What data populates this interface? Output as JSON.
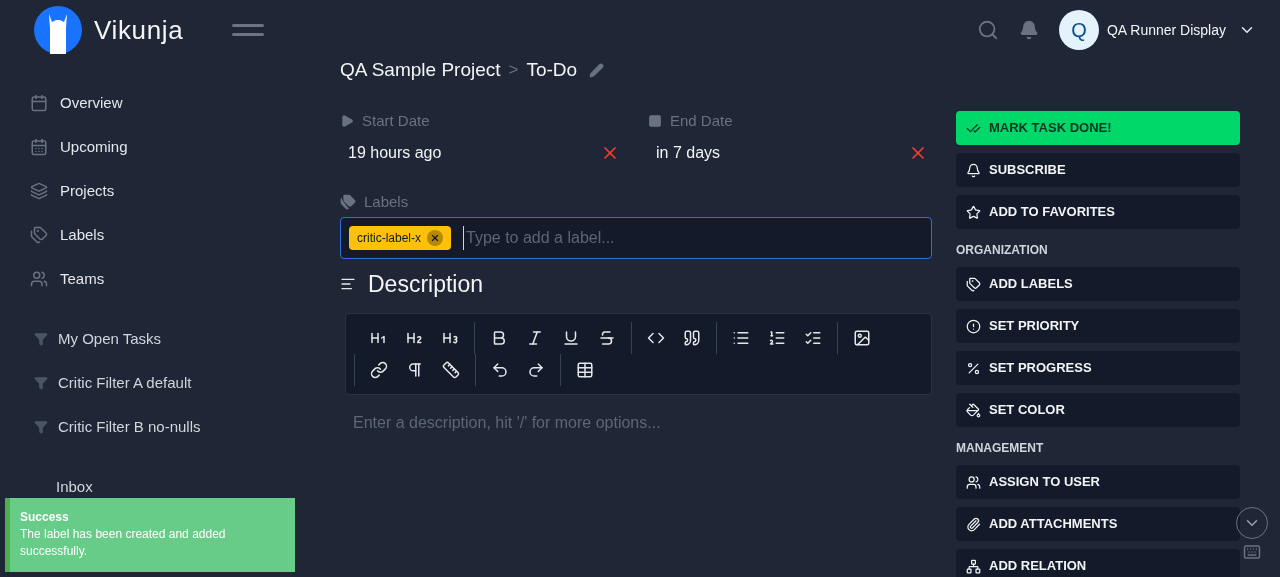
{
  "header": {
    "brand": "Vikunja",
    "user": {
      "initial": "Q",
      "name": "QA Runner Display"
    }
  },
  "sidebar": {
    "nav": [
      {
        "kind": "overview",
        "label": "Overview"
      },
      {
        "kind": "upcoming",
        "label": "Upcoming"
      },
      {
        "kind": "projects",
        "label": "Projects"
      },
      {
        "kind": "labels",
        "label": "Labels"
      },
      {
        "kind": "teams",
        "label": "Teams"
      }
    ],
    "filters": [
      "My Open Tasks",
      "Critic Filter A default",
      "Critic Filter B no-nulls"
    ],
    "projects": [
      "Inbox"
    ]
  },
  "breadcrumb": {
    "project": "QA Sample Project",
    "separator": ">",
    "view": "To-Do"
  },
  "dates": [
    {
      "kind": "start",
      "label": "Start Date",
      "value": "19 hours ago"
    },
    {
      "kind": "end",
      "label": "End Date",
      "value": "in 7 days"
    }
  ],
  "labels": {
    "heading": "Labels",
    "tags": [
      {
        "text": "critic-label-x",
        "color": "#ffc107"
      }
    ],
    "placeholder": "Type to add a label..."
  },
  "description": {
    "heading": "Description",
    "placeholder": "Enter a description, hit '/' for more options..."
  },
  "actions": [
    {
      "kind": "done",
      "label": "MARK TASK DONE!"
    },
    {
      "kind": "subscribe",
      "label": "SUBSCRIBE"
    },
    {
      "kind": "favorite",
      "label": "ADD TO FAVORITES"
    },
    {
      "kind": "heading",
      "label": "ORGANIZATION"
    },
    {
      "kind": "labels",
      "label": "ADD LABELS"
    },
    {
      "kind": "priority",
      "label": "SET PRIORITY"
    },
    {
      "kind": "progress",
      "label": "SET PROGRESS"
    },
    {
      "kind": "color",
      "label": "SET COLOR"
    },
    {
      "kind": "heading",
      "label": "MANAGEMENT"
    },
    {
      "kind": "assign",
      "label": "ASSIGN TO USER"
    },
    {
      "kind": "attach",
      "label": "ADD ATTACHMENTS"
    },
    {
      "kind": "relation",
      "label": "ADD RELATION"
    }
  ],
  "toast": {
    "title": "Success",
    "message": "The label has been created and added successfully."
  }
}
